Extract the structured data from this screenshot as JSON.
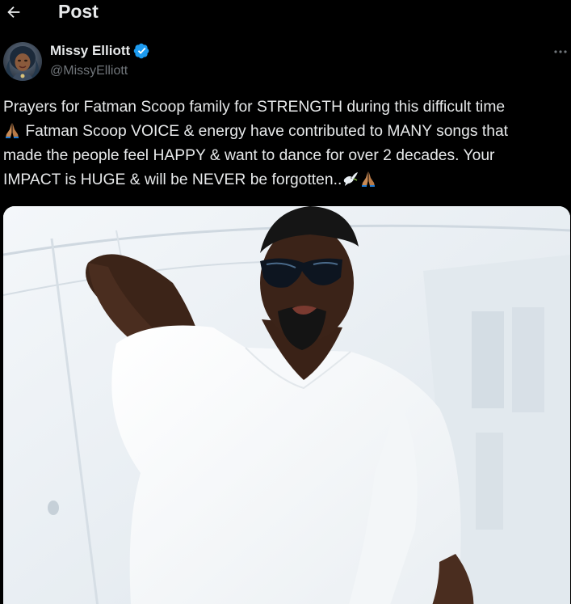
{
  "header": {
    "title": "Post",
    "back_icon": "arrow-left-icon"
  },
  "author": {
    "name": "Missy Elliott",
    "handle": "@MissyElliott",
    "verified": true,
    "verified_color": "#1d9bf0"
  },
  "tweet": {
    "lines": [
      "Prayers for Fatman Scoop family for STRENGTH during this difficult time",
      "Fatman Scoop VOICE & energy have contributed to MANY songs that",
      "made the people feel HAPPY & want to dance for over 2 decades. Your",
      "IMPACT is HUGE & will be NEVER be forgotten.."
    ],
    "emojis": [
      "praying-hands-icon",
      "dove-icon",
      "praying-hands-icon"
    ]
  },
  "colors": {
    "background": "#000000",
    "text": "#e7e9ea",
    "secondary": "#71767b"
  }
}
